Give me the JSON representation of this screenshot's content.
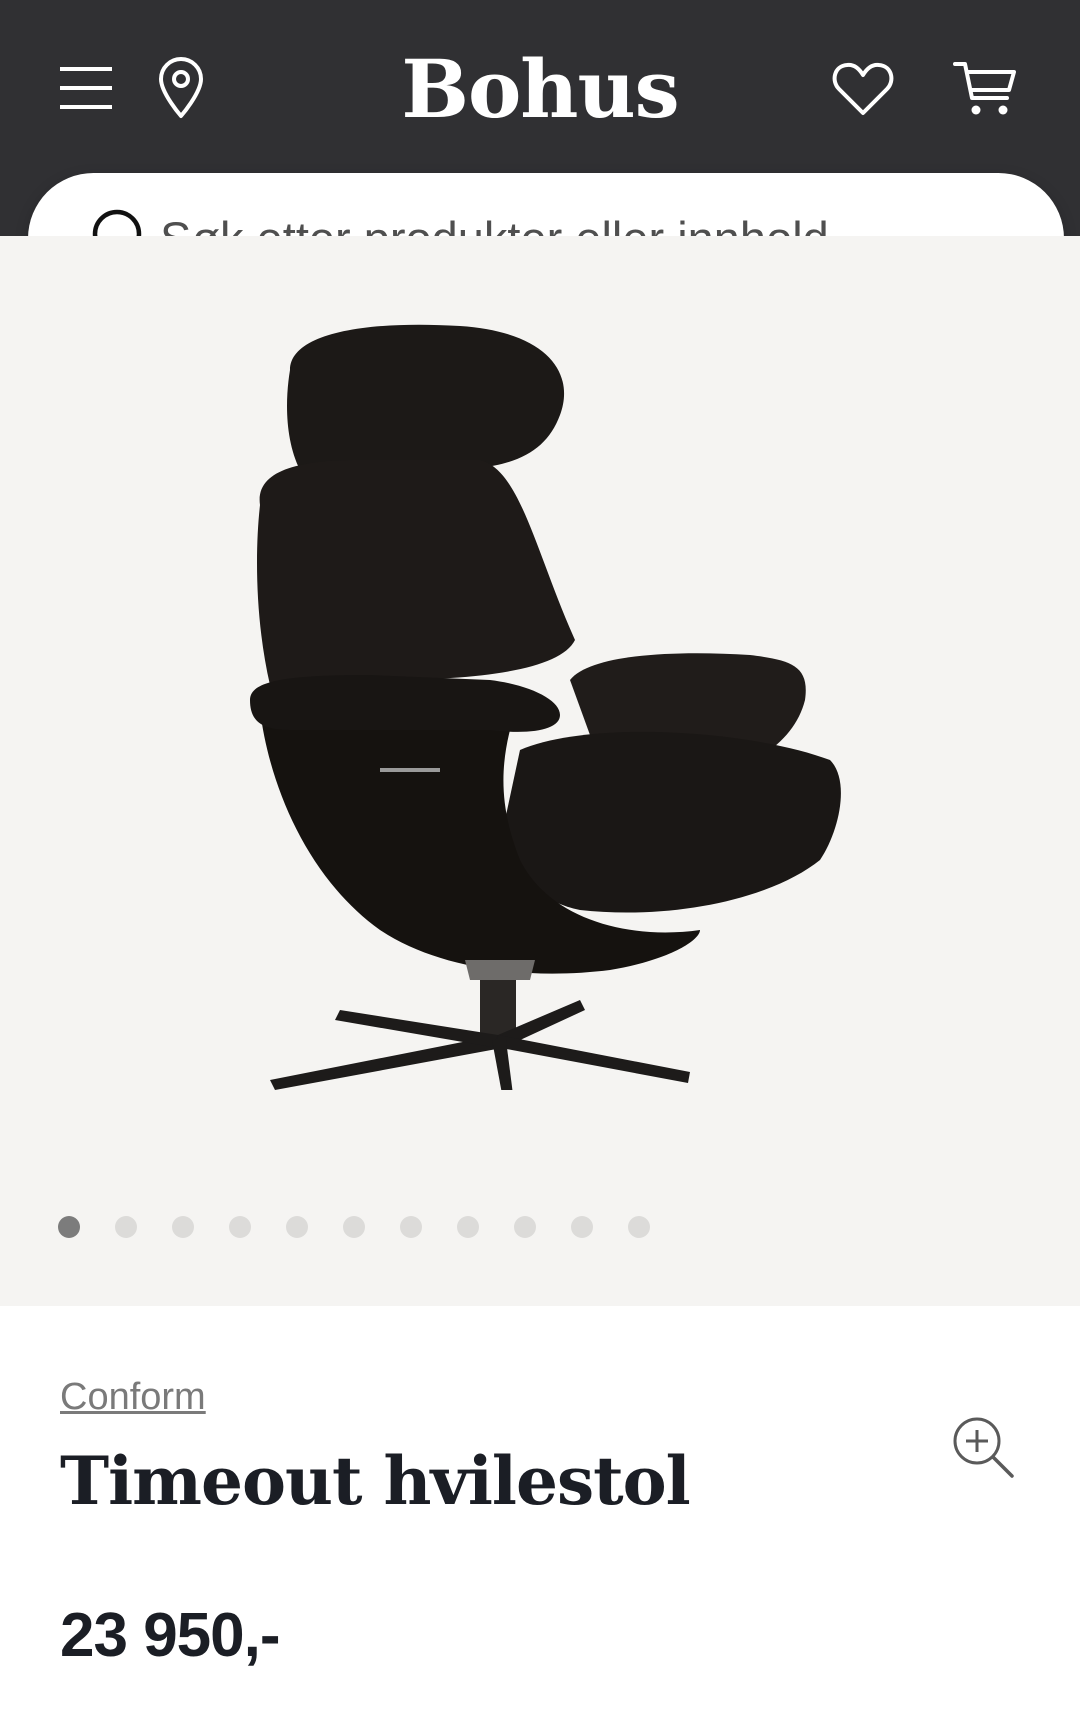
{
  "header": {
    "logo": "Bohus",
    "menu_icon": "hamburger-menu-icon",
    "location_icon": "map-pin-icon",
    "wishlist_icon": "heart-icon",
    "cart_icon": "shopping-cart-icon"
  },
  "search": {
    "placeholder": "Søk etter produkter eller innhold...",
    "icon": "search-icon"
  },
  "gallery": {
    "image_count": 11,
    "active_index": 0,
    "zoom_icon": "zoom-in-icon"
  },
  "product": {
    "brand": "Conform",
    "title": "Timeout hvilestol",
    "price": "23 950,-"
  },
  "colors": {
    "header_bg": "#303033",
    "gallery_bg": "#f5f4f2",
    "text_dark": "#1b1e25",
    "dot_active": "#7c7c7c",
    "dot_inactive": "#dcdbd9"
  }
}
